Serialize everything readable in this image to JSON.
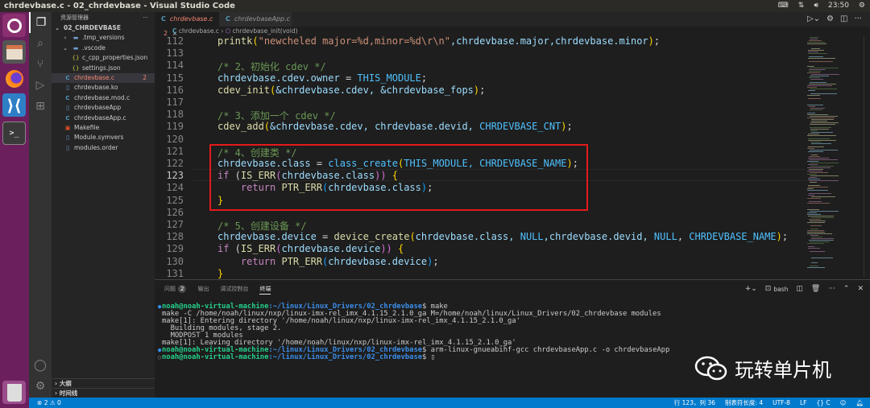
{
  "window_title": "chrdevbase.c - 02_chrdevbase - Visual Studio Code",
  "system_tray": {
    "clock": "23:50",
    "icons": [
      "keyboard-icon",
      "network-icon",
      "volume-icon",
      "power-gear-icon"
    ]
  },
  "launcher": [
    "ubuntu-icon",
    "files-icon",
    "firefox-icon",
    "vscode-icon",
    "terminal-icon",
    "trash-icon"
  ],
  "sidebar": {
    "title": "资源管理器",
    "more": "···",
    "root": "02_CHRDEVBASE",
    "items": [
      {
        "label": ".tmp_versions",
        "type": "folder",
        "indent": 1,
        "twisty": "›"
      },
      {
        "label": ".vscode",
        "type": "folder-open",
        "indent": 1,
        "twisty": "⌄"
      },
      {
        "label": "c_cpp_properties.json",
        "type": "json",
        "indent": 2
      },
      {
        "label": "settings.json",
        "type": "json",
        "indent": 2
      },
      {
        "label": "chrdevbase.c",
        "type": "c",
        "indent": 1,
        "badge": "2",
        "selected": true
      },
      {
        "label": "chrdevbase.ko",
        "type": "file",
        "indent": 1
      },
      {
        "label": "chrdevbase.mod.c",
        "type": "c",
        "indent": 1
      },
      {
        "label": "chrdevbaseApp",
        "type": "file",
        "indent": 1
      },
      {
        "label": "chrdevbaseApp.c",
        "type": "c",
        "indent": 1
      },
      {
        "label": "Makefile",
        "type": "makefile",
        "indent": 1
      },
      {
        "label": "Module.symvers",
        "type": "file",
        "indent": 1
      },
      {
        "label": "modules.order",
        "type": "file",
        "indent": 1
      }
    ],
    "outline": "大纲",
    "timeline": "时间线"
  },
  "tabs": [
    {
      "label": "chrdevbase.c",
      "badge": "2",
      "active": true
    },
    {
      "label": "chrdevbaseApp.c",
      "active": false
    }
  ],
  "breadcrumb": {
    "file": "chrdevbase.c",
    "symbol": "chrdevbase_init(void)"
  },
  "editor": {
    "current_line": 123,
    "lines": [
      {
        "n": 112,
        "t": [
          [
            "printk",
            "fn"
          ],
          [
            "(",
            "br"
          ],
          [
            "\"newcheled major=%d,minor=%d\\r\\n\"",
            "str"
          ],
          [
            ",chrdevbase.major,chrdevbase.minor",
            "id"
          ],
          [
            ")",
            "br"
          ],
          [
            ";",
            "p"
          ]
        ]
      },
      {
        "n": 113,
        "t": []
      },
      {
        "n": 114,
        "t": [
          [
            "/* 2、初始化 cdev */",
            "cm"
          ]
        ]
      },
      {
        "n": 115,
        "t": [
          [
            "chrdevbase.cdev.owner",
            "id"
          ],
          [
            " = ",
            "p"
          ],
          [
            "THIS_MODULE",
            "mac"
          ],
          [
            ";",
            "p"
          ]
        ]
      },
      {
        "n": 116,
        "t": [
          [
            "cdev_init",
            "fn"
          ],
          [
            "(",
            "br"
          ],
          [
            "&chrdevbase.cdev, &chrdevbase_fops",
            "id"
          ],
          [
            ")",
            "br"
          ],
          [
            ";",
            "p"
          ]
        ]
      },
      {
        "n": 117,
        "t": []
      },
      {
        "n": 118,
        "t": [
          [
            "/* 3、添加一个 cdev */",
            "cm"
          ]
        ]
      },
      {
        "n": 119,
        "t": [
          [
            "cdev_add",
            "fn"
          ],
          [
            "(",
            "br"
          ],
          [
            "&chrdevbase.cdev, chrdevbase.devid, ",
            "id"
          ],
          [
            "CHRDEVBASE_CNT",
            "mac"
          ],
          [
            ")",
            "br"
          ],
          [
            ";",
            "p"
          ]
        ]
      },
      {
        "n": 120,
        "t": []
      },
      {
        "n": 121,
        "t": [
          [
            "/* 4、创建类 */",
            "cm"
          ]
        ]
      },
      {
        "n": 122,
        "t": [
          [
            "chrdevbase.class",
            "id"
          ],
          [
            " = ",
            "p"
          ],
          [
            "class_create",
            "mac"
          ],
          [
            "(",
            "br"
          ],
          [
            "THIS_MODULE, CHRDEVBASE_NAME",
            "mac"
          ],
          [
            ")",
            "br"
          ],
          [
            ";",
            "p"
          ]
        ]
      },
      {
        "n": 123,
        "t": [
          [
            "if",
            "kw"
          ],
          [
            " (",
            "p"
          ],
          [
            "IS_ERR",
            "fn"
          ],
          [
            "(",
            "br2"
          ],
          [
            "chrdevbase.class",
            "id"
          ],
          [
            "))",
            "br2"
          ],
          [
            " {",
            "br"
          ]
        ]
      },
      {
        "n": 124,
        "t": [
          [
            "    return",
            "kw"
          ],
          [
            " PTR_ERR",
            "fn"
          ],
          [
            "(",
            "br3"
          ],
          [
            "chrdevbase.class",
            "id"
          ],
          [
            ")",
            "br3"
          ],
          [
            ";",
            "p"
          ]
        ]
      },
      {
        "n": 125,
        "t": [
          [
            "}",
            "br"
          ]
        ]
      },
      {
        "n": 126,
        "t": []
      },
      {
        "n": 127,
        "t": [
          [
            "/* 5、创建设备 */",
            "cm"
          ]
        ]
      },
      {
        "n": 128,
        "t": [
          [
            "chrdevbase.device",
            "id"
          ],
          [
            " = ",
            "p"
          ],
          [
            "device_create",
            "fn"
          ],
          [
            "(",
            "br"
          ],
          [
            "chrdevbase.class, ",
            "id"
          ],
          [
            "NULL",
            "mac"
          ],
          [
            ",chrdevbase.devid, ",
            "id"
          ],
          [
            "NULL",
            "mac"
          ],
          [
            ", ",
            "p"
          ],
          [
            "CHRDEVBASE_NAME",
            "mac"
          ],
          [
            ")",
            "br"
          ],
          [
            ";",
            "p"
          ]
        ]
      },
      {
        "n": 129,
        "t": [
          [
            "if",
            "kw"
          ],
          [
            " (",
            "p"
          ],
          [
            "IS_ERR",
            "fn"
          ],
          [
            "(",
            "br2"
          ],
          [
            "chrdevbase.device",
            "id"
          ],
          [
            "))",
            "br2"
          ],
          [
            " {",
            "br"
          ]
        ]
      },
      {
        "n": 130,
        "t": [
          [
            "    return",
            "kw"
          ],
          [
            " PTR_ERR",
            "fn"
          ],
          [
            "(",
            "br3"
          ],
          [
            "chrdevbase.device",
            "id"
          ],
          [
            ")",
            "br3"
          ],
          [
            ";",
            "p"
          ]
        ]
      },
      {
        "n": 131,
        "t": [
          [
            "}",
            "br"
          ]
        ]
      }
    ]
  },
  "panel": {
    "tabs": [
      {
        "label": "问题",
        "badge": "2"
      },
      {
        "label": "输出"
      },
      {
        "label": "调试控制台"
      },
      {
        "label": "终端",
        "active": true
      }
    ],
    "shell": "bash",
    "terminal": [
      {
        "prompt": true,
        "user": "noah@noah-virtual-machine",
        "path": ":~/linux/Linux_Drivers/02_chrdevbase",
        "cmd": "$ make"
      },
      {
        "text": "make -C /home/noah/linux/nxp/linux-imx-rel_imx_4.1.15_2.1.0_ga M=/home/noah/linux/Linux_Drivers/02_chrdevbase modules"
      },
      {
        "text": "make[1]: Entering directory '/home/noah/linux/nxp/linux-imx-rel_imx_4.1.15_2.1.0_ga'"
      },
      {
        "text": "  Building modules, stage 2."
      },
      {
        "text": "  MODPOST 1 modules"
      },
      {
        "text": "make[1]: Leaving directory '/home/noah/linux/nxp/linux-imx-rel_imx_4.1.15_2.1.0_ga'"
      },
      {
        "prompt": true,
        "user": "noah@noah-virtual-machine",
        "path": ":~/linux/Linux_Drivers/02_chrdevbase",
        "cmd": "$ arm-linux-gnueabihf-gcc chrdevbaseApp.c -o chrdevbaseApp"
      },
      {
        "prompt": true,
        "empty": true,
        "user": "noah@noah-virtual-machine",
        "path": ":~/linux/Linux_Drivers/02_chrdevbase",
        "cmd": "$ ▯"
      }
    ]
  },
  "status": {
    "errors": "2",
    "warnings": "0",
    "position": "行 123，列 36",
    "tab_size": "制表符长度: 4",
    "encoding": "UTF-8",
    "eol": "LF",
    "language": "{} C"
  },
  "watermark": "玩转单片机"
}
